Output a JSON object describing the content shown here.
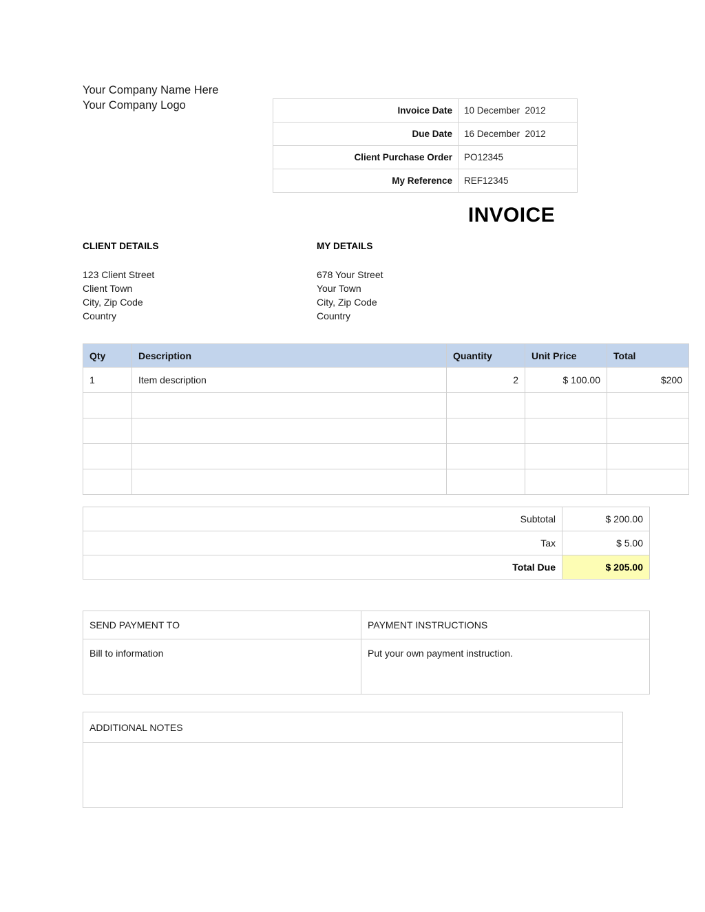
{
  "document": {
    "title": "INVOICE",
    "company": {
      "name_line": "Your Company Name Here",
      "logo_line": "Your Company Logo"
    },
    "meta": {
      "rows": [
        {
          "label": "Invoice Date",
          "value": "10 December  2012"
        },
        {
          "label": "Due Date",
          "value": "16 December  2012"
        },
        {
          "label": "Client Purchase Order",
          "value": "PO12345"
        },
        {
          "label": "My Reference",
          "value": "REF12345"
        }
      ]
    },
    "client_details": {
      "heading": "CLIENT DETAILS",
      "lines": [
        "123 Client Street",
        "Client Town",
        "City, Zip Code",
        "Country"
      ]
    },
    "my_details": {
      "heading": "MY DETAILS",
      "lines": [
        "678 Your Street",
        "Your Town",
        "City, Zip Code",
        "Country"
      ]
    },
    "line_items": {
      "headers": [
        "Qty",
        "Description",
        "Quantity",
        "Unit Price",
        "Total"
      ],
      "rows": [
        {
          "qty": "1",
          "description": "Item description",
          "quantity": "2",
          "unit_price": "$ 100.00",
          "total": "$200"
        },
        {
          "qty": "",
          "description": "",
          "quantity": "",
          "unit_price": "",
          "total": ""
        },
        {
          "qty": "",
          "description": "",
          "quantity": "",
          "unit_price": "",
          "total": ""
        },
        {
          "qty": "",
          "description": "",
          "quantity": "",
          "unit_price": "",
          "total": ""
        },
        {
          "qty": "",
          "description": "",
          "quantity": "",
          "unit_price": "",
          "total": ""
        }
      ]
    },
    "totals": {
      "rows": [
        {
          "label": "Subtotal",
          "value": "$ 200.00"
        },
        {
          "label": "Tax",
          "value": "$ 5.00"
        },
        {
          "label": "Total Due",
          "value": "$ 205.00"
        }
      ]
    },
    "payment": {
      "send_payment_heading": "SEND PAYMENT TO",
      "send_payment_body": "Bill to information",
      "instructions_heading": "PAYMENT INSTRUCTIONS",
      "instructions_body": "Put your own payment instruction."
    },
    "notes": {
      "heading": "ADDITIONAL NOTES",
      "body": ""
    },
    "colors": {
      "table_header_blue": "#c2d4ec",
      "total_due_highlight": "#fdfdb4",
      "border_gray": "#cfcfcf",
      "text": "#1a1a1a"
    }
  }
}
